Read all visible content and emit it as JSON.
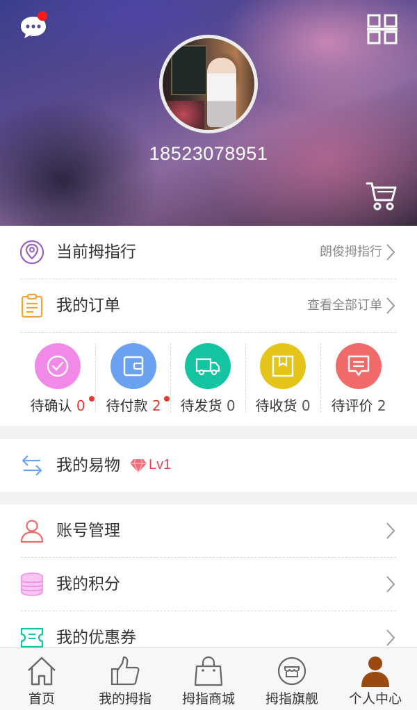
{
  "header": {
    "phone": "18523078951",
    "has_unread_message": true
  },
  "current_bank": {
    "title": "当前拇指行",
    "value": "朗俊拇指行"
  },
  "orders": {
    "title": "我的订单",
    "view_all": "查看全部订单",
    "statuses": [
      {
        "label": "待确认",
        "count": "0",
        "color": "#f08ae6",
        "count_color": "red",
        "dot": true
      },
      {
        "label": "待付款",
        "count": "2",
        "color": "#6aa2ef",
        "count_color": "red",
        "dot": true
      },
      {
        "label": "待发货",
        "count": "0",
        "color": "#14c3a0",
        "count_color": "gray",
        "dot": false
      },
      {
        "label": "待收货",
        "count": "0",
        "color": "#e5c41a",
        "count_color": "gray",
        "dot": false
      },
      {
        "label": "待评价",
        "count": "2",
        "color": "#f06a6a",
        "count_color": "gray",
        "dot": false
      }
    ]
  },
  "trade": {
    "title": "我的易物",
    "level": "Lv1"
  },
  "menu": [
    {
      "title": "账号管理",
      "icon": "user-icon"
    },
    {
      "title": "我的积分",
      "icon": "coins-icon"
    },
    {
      "title": "我的优惠券",
      "icon": "coupon-icon"
    }
  ],
  "nav": [
    {
      "label": "首页",
      "icon": "home-icon",
      "active": false
    },
    {
      "label": "我的拇指",
      "icon": "thumb-icon",
      "active": false
    },
    {
      "label": "拇指商城",
      "icon": "bag-icon",
      "active": false
    },
    {
      "label": "拇指旗舰",
      "icon": "store-icon",
      "active": false
    },
    {
      "label": "个人中心",
      "icon": "person-icon",
      "active": true
    }
  ],
  "colors": {
    "accent_red": "#e53935",
    "active_nav": "#9a4a10",
    "location_icon": "#9b5fc0",
    "order_icon": "#f2a23a",
    "trade_icon": "#6aa2ef",
    "user_icon": "#f06a6a",
    "coins_icon": "#f08ae6",
    "coupon_icon": "#14c3a0"
  }
}
